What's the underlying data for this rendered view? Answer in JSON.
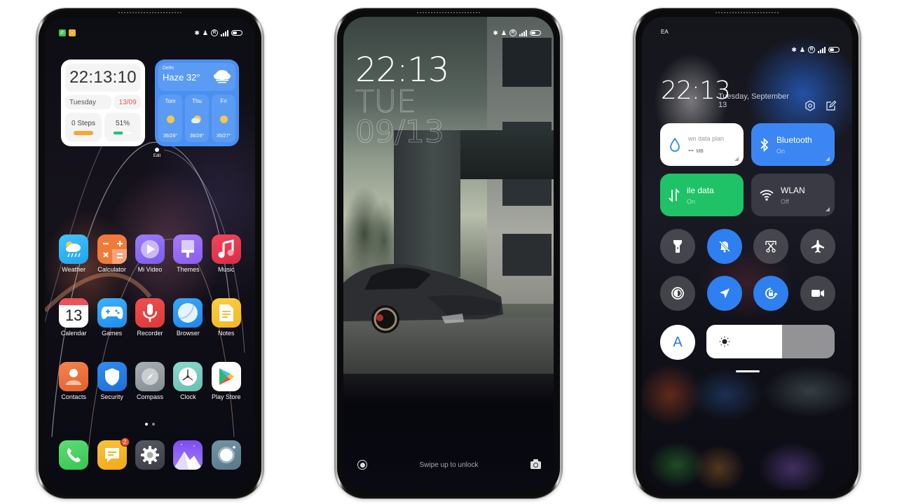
{
  "status_bar": {
    "icons": [
      "bluetooth-icon",
      "silent-bell-icon",
      "registered-r-icon",
      "signal-e-icon",
      "battery-icon"
    ],
    "network_type": "E",
    "notification_apps": [
      "phone-app-icon",
      "messages-app-icon"
    ]
  },
  "home_screen": {
    "clock_widget": {
      "time": "22:13:10",
      "day": "Tuesday",
      "date": "13/09",
      "steps": "0 Steps",
      "battery": "51%",
      "battery_level": 0.51
    },
    "weather_widget": {
      "city": "Delhi",
      "condition": "Haze 32°",
      "forecast": [
        {
          "day": "Tom",
          "temp": "36/28°",
          "icon": "sunny-icon"
        },
        {
          "day": "Thu",
          "temp": "36/28°",
          "icon": "partly-cloudy-icon"
        },
        {
          "day": "Fri",
          "temp": "35/27°",
          "icon": "sunny-icon"
        }
      ]
    },
    "edit_label": "Edit",
    "apps_row1": [
      {
        "label": "Weather",
        "color": "#2fb6f5"
      },
      {
        "label": "Calculator",
        "color": "#f07a3a"
      },
      {
        "label": "Mi Video",
        "color": "#8c6cf2"
      },
      {
        "label": "Themes",
        "color": "#9a6cf0"
      },
      {
        "label": "Music",
        "color": "#e63950"
      }
    ],
    "apps_row2": [
      {
        "label": "Calendar",
        "day_number": "13"
      },
      {
        "label": "Games",
        "color": "#2f9cf5"
      },
      {
        "label": "Recorder",
        "color": "#e84545"
      },
      {
        "label": "Browser",
        "color": "#2d9cf3"
      },
      {
        "label": "Notes",
        "color": "#f6c22e"
      }
    ],
    "apps_row3": [
      {
        "label": "Contacts",
        "color": "#ee6e3c"
      },
      {
        "label": "Security",
        "color": "#2b7fe0"
      },
      {
        "label": "Compass",
        "color": "#9aa3a8"
      },
      {
        "label": "Clock",
        "color": "#7fcfc3"
      },
      {
        "label": "Play Store",
        "color": "#ffffff"
      }
    ],
    "page_indicator": {
      "pages": 2,
      "current": 1
    },
    "dock": [
      {
        "name": "phone",
        "color": "#4cd164"
      },
      {
        "name": "messages",
        "color": "#f5b21f",
        "badge": "2"
      },
      {
        "name": "settings",
        "color": "#4a4d55"
      },
      {
        "name": "gallery",
        "color": "#8a5cf5"
      },
      {
        "name": "camera",
        "color": "#6b8a9a"
      }
    ]
  },
  "lock_screen": {
    "time": "22:13",
    "day": "TUE",
    "date": "09/13",
    "hint": "Swipe up to unlock"
  },
  "control_center": {
    "carrier": "EA",
    "time": "22:13",
    "date": "Tuesday, September 13",
    "tiles": [
      {
        "title": "wn data plan",
        "value": "--",
        "unit": "MB",
        "icon": "water-drop-icon",
        "state": "neutral"
      },
      {
        "title": "Bluetooth",
        "sub": "On",
        "icon": "bluetooth-icon",
        "state": "on",
        "color": "#3b86f3"
      },
      {
        "title": "ile data",
        "sub": "On",
        "icon": "mobile-data-icon",
        "state": "on",
        "color": "#1fc266"
      },
      {
        "title": "WLAN",
        "sub": "Off",
        "icon": "wifi-icon",
        "state": "off"
      }
    ],
    "toggles": [
      {
        "name": "flashlight",
        "on": false
      },
      {
        "name": "silent",
        "on": true
      },
      {
        "name": "screenshot",
        "on": false
      },
      {
        "name": "airplane-mode",
        "on": false
      },
      {
        "name": "reading-mode",
        "on": false
      },
      {
        "name": "location",
        "on": true
      },
      {
        "name": "rotation-lock",
        "on": true
      },
      {
        "name": "screen-recorder",
        "on": false
      }
    ],
    "auto_brightness_label": "A",
    "brightness_level": 0.59,
    "accent": "#2e7ff0"
  }
}
